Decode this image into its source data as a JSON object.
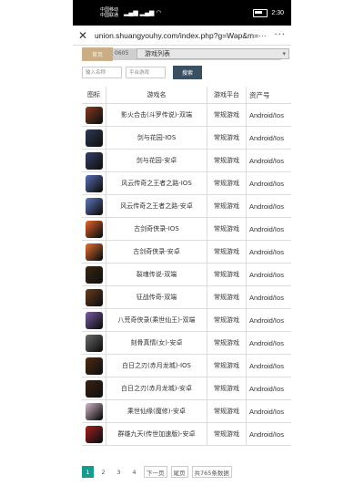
{
  "status": {
    "carrier1": "中国移动",
    "carrier2": "中国联通",
    "signal": "ᵢₗ ᵢₗ",
    "wifi": "wifi",
    "time": "2:30"
  },
  "browser": {
    "url": "union.shuangyouhy.com/index.php?g=Wap&m=···",
    "menu": "···"
  },
  "nav": {
    "home": "首页",
    "code": "0605",
    "select": "游戏列表"
  },
  "filters": {
    "type": "输入名称",
    "platform": "平台游戏",
    "search": "搜索"
  },
  "table": {
    "headers": [
      "图标",
      "游戏名",
      "游戏平台",
      "资产号"
    ],
    "rows": [
      {
        "name": "影火合击(斗罗传说)-双端",
        "platform": "常规游戏",
        "asset": "Android/Ios",
        "color": "#8a3b1c"
      },
      {
        "name": "剑与花园-IOS",
        "platform": "常规游戏",
        "asset": "Android/Ios",
        "color": "#2d3b57"
      },
      {
        "name": "剑与花园-安卓",
        "platform": "常规游戏",
        "asset": "Android/Ios",
        "color": "#34406a"
      },
      {
        "name": "风云传奇之王者之路-IOS",
        "platform": "常规游戏",
        "asset": "Android/Ios",
        "color": "#5a6fb8"
      },
      {
        "name": "风云传奇之王者之路-安卓",
        "platform": "常规游戏",
        "asset": "Android/Ios",
        "color": "#6079c0"
      },
      {
        "name": "古剑奇侠录-IOS",
        "platform": "常规游戏",
        "asset": "Android/Ios",
        "color": "#e8642a"
      },
      {
        "name": "古剑奇侠录-安卓",
        "platform": "常规游戏",
        "asset": "Android/Ios",
        "color": "#e9702f"
      },
      {
        "name": "裂魂传说-双端",
        "platform": "常规游戏",
        "asset": "Android/Ios",
        "color": "#3a2410"
      },
      {
        "name": "征战传奇-双端",
        "platform": "常规游戏",
        "asset": "Android/Ios",
        "color": "#6a3b1a"
      },
      {
        "name": "八荒奇侠录(乘世仙王)-双端",
        "platform": "常规游戏",
        "asset": "Android/Ios",
        "color": "#7b5aa8"
      },
      {
        "name": "刻骨真情(女)-安卓",
        "platform": "常规游戏",
        "asset": "Android/Ios",
        "color": "#6b6b6b"
      },
      {
        "name": "白日之刃(赤月龙城)-IOS",
        "platform": "常规游戏",
        "asset": "Android/Ios",
        "color": "#4d2a12"
      },
      {
        "name": "白日之刃(赤月龙城)-安卓",
        "platform": "常规游戏",
        "asset": "Android/Ios",
        "color": "#3b2010"
      },
      {
        "name": "乘世仙缘(魔修)-安卓",
        "platform": "常规游戏",
        "asset": "Android/Ios",
        "color": "#d6b8c8"
      },
      {
        "name": "群雄九天(传世加速版)-安卓",
        "platform": "常规游戏",
        "asset": "Android/Ios",
        "color": "#a81e1e"
      }
    ]
  },
  "pager": {
    "pages": [
      "1",
      "2",
      "3",
      "4"
    ],
    "next": "下一页",
    "last": "尾页",
    "total": "共765条数据"
  }
}
